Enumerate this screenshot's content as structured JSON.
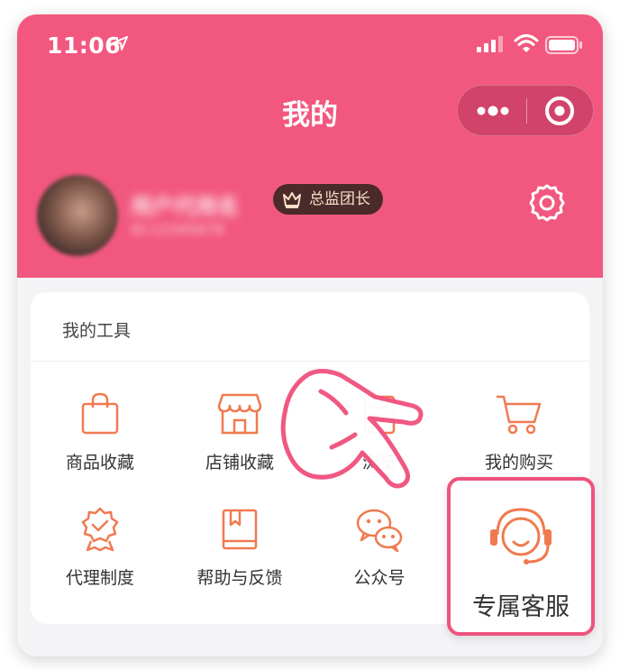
{
  "status_bar": {
    "time": "11:06"
  },
  "header": {
    "title": "我的"
  },
  "user": {
    "name": "用户代用名",
    "id": "ID:12345678",
    "badge": "总监团长"
  },
  "tools": {
    "title": "我的工具",
    "items": [
      {
        "label": "商品收藏",
        "icon": "shopping-bag-icon"
      },
      {
        "label": "店铺收藏",
        "icon": "store-icon"
      },
      {
        "label": "浏览",
        "icon": "history-icon"
      },
      {
        "label": "我的购买",
        "icon": "cart-icon"
      },
      {
        "label": "代理制度",
        "icon": "award-badge-icon"
      },
      {
        "label": "帮助与反馈",
        "icon": "book-icon"
      },
      {
        "label": "公众号",
        "icon": "wechat-icon"
      }
    ]
  },
  "highlight": {
    "label": "专属客服",
    "icon": "customer-service-icon"
  },
  "colors": {
    "header": "#f2587f",
    "accent": "#f07a50",
    "highlight_border": "#f0527d",
    "badge_bg": "#4a2a2a"
  }
}
